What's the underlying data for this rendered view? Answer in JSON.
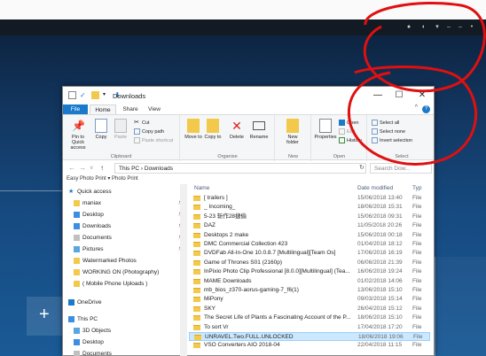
{
  "taskbar": {
    "icons": [
      "network-icon",
      "volume-icon",
      "chevron-icon",
      "minimize-icon",
      "restore-icon",
      "close-icon"
    ]
  },
  "desktop": {
    "tile_glyph": "+"
  },
  "window": {
    "title": "Downloads",
    "controls": {
      "minimize": "—",
      "maximize": "☐",
      "close": "✕"
    },
    "tabs": {
      "file": "File",
      "home": "Home",
      "share": "Share",
      "view": "View",
      "collapse": "^",
      "help": "?"
    },
    "ribbon": {
      "clipboard": {
        "label": "Clipboard",
        "pin": "Pin to Quick access",
        "copy": "Copy",
        "paste": "Paste",
        "cut": "Cut",
        "copy_path": "Copy path",
        "paste_shortcut": "Paste shortcut"
      },
      "organise": {
        "label": "Organise",
        "move_to": "Move to",
        "copy_to": "Copy to",
        "delete": "Delete",
        "rename": "Rename"
      },
      "new": {
        "label": "New",
        "new_folder": "New folder"
      },
      "open": {
        "label": "Open",
        "properties": "Properties",
        "open": "Open",
        "edit": "Edit",
        "history": "History"
      },
      "select": {
        "label": "Select",
        "select_all": "Select all",
        "select_none": "Select none",
        "invert": "Invert selection"
      }
    },
    "address": {
      "back": "←",
      "forward": "→",
      "recent": "∨",
      "up": "↑",
      "path": "This PC  ›  Downloads",
      "refresh": "↻",
      "search_placeholder": "Search Dow..."
    },
    "epson_bar": "Easy Photo Print  ▾  Photo Print",
    "nav_items": [
      {
        "label": "Quick access",
        "icon": "star-icon",
        "pin": ""
      },
      {
        "label": "maniax",
        "icon": "folder-icon",
        "pin": "📌"
      },
      {
        "label": "Desktop",
        "icon": "desktop-icon",
        "pin": "📌"
      },
      {
        "label": "Downloads",
        "icon": "downloads-icon",
        "pin": "📌"
      },
      {
        "label": "Documents",
        "icon": "documents-icon",
        "pin": "📌"
      },
      {
        "label": "Pictures",
        "icon": "pictures-icon",
        "pin": "📌"
      },
      {
        "label": "Watermarked Photos",
        "icon": "folder-icon",
        "pin": ""
      },
      {
        "label": "WORKING ON (Photography)",
        "icon": "folder-icon",
        "pin": ""
      },
      {
        "label": "( Mobile Phone Uploads )",
        "icon": "folder-icon",
        "pin": ""
      },
      {
        "label": "OneDrive",
        "icon": "cloud-icon",
        "pin": ""
      },
      {
        "label": "This PC",
        "icon": "computer-icon",
        "pin": ""
      },
      {
        "label": "3D Objects",
        "icon": "objects-icon",
        "pin": ""
      },
      {
        "label": "Desktop",
        "icon": "desktop-icon",
        "pin": ""
      },
      {
        "label": "Documents",
        "icon": "documents-icon",
        "pin": ""
      }
    ],
    "columns": {
      "name": "Name",
      "date": "Date modified",
      "type": "Typ"
    },
    "files": [
      {
        "name": "[ trailers ]",
        "date": "15/06/2018 13:40",
        "type": "File"
      },
      {
        "name": "_ Incoming_",
        "date": "18/06/2018 15:31",
        "type": "File"
      },
      {
        "name": "5-23 斩作28捷偷",
        "date": "15/06/2018 09:31",
        "type": "File"
      },
      {
        "name": "DAZ",
        "date": "11/05/2018 20:26",
        "type": "File"
      },
      {
        "name": "Desktops 2 make",
        "date": "15/06/2018 00:18",
        "type": "File"
      },
      {
        "name": "DMC Commercial Collection 423",
        "date": "01/04/2018 18:12",
        "type": "File"
      },
      {
        "name": "DVDFab All-In-One 10.0.8.7 [Multilingual][Team Os]",
        "date": "17/06/2018 16:19",
        "type": "File"
      },
      {
        "name": "Game of Thrones S01 (2160p)",
        "date": "06/06/2018 21:39",
        "type": "File"
      },
      {
        "name": "InPixio Photo Clip Professional [8.0.0][Multilingual] (Tea...",
        "date": "16/06/2018 19:24",
        "type": "File"
      },
      {
        "name": "MAME Downloads",
        "date": "01/02/2018 14:06",
        "type": "File"
      },
      {
        "name": "mb_bios_z370-aorus-gaming-7_f6(1)",
        "date": "13/06/2018 15:10",
        "type": "File"
      },
      {
        "name": "MiPony",
        "date": "09/03/2018 15:14",
        "type": "File"
      },
      {
        "name": "SKY",
        "date": "26/04/2018 15:12",
        "type": "File"
      },
      {
        "name": "The Secret Life of Plants a Fascinating Account of the P...",
        "date": "18/06/2018 15:10",
        "type": "File"
      },
      {
        "name": "To sort Vr",
        "date": "17/04/2018 17:20",
        "type": "File"
      },
      {
        "name": "UNRAVEL.Two.FULL.UNLOCKED",
        "date": "18/06/2018 19:06",
        "type": "File"
      },
      {
        "name": "VSO Converters AIO 2018-04",
        "date": "22/04/2018 11:15",
        "type": "File"
      }
    ],
    "selected_index": 15
  },
  "colors": {
    "annotation": "#e01010",
    "accent": "#1979ca",
    "selection": "#cce8ff"
  }
}
